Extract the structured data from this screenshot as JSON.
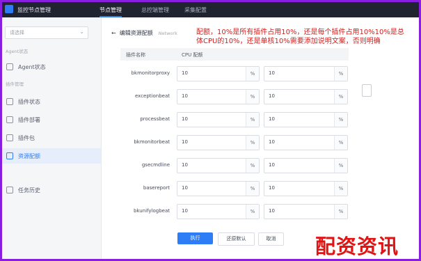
{
  "app": {
    "name": "监控节点管理"
  },
  "topnav": [
    {
      "label": "节点管理",
      "active": true
    },
    {
      "label": "总控端管理",
      "active": false
    },
    {
      "label": "采集配置",
      "active": false
    }
  ],
  "sidebar": {
    "select_placeholder": "请选择",
    "group1": "Agent状态",
    "group2": "插件管理",
    "items": [
      {
        "label": "Agent状态",
        "active": false
      },
      {
        "label": "插件状态",
        "active": false
      },
      {
        "label": "插件部署",
        "active": false
      },
      {
        "label": "插件包",
        "active": false
      },
      {
        "label": "资源配额",
        "active": true
      },
      {
        "label": "任务历史",
        "active": false
      }
    ]
  },
  "page": {
    "back_label": "编辑资源配额",
    "back_sub": "Network",
    "annotation": "配额，10%是所有插件占用10%，还是每个插件占用10%10%是总体CPU的10%，还是单核10%需要添加说明文案，否则明确"
  },
  "table": {
    "col_name": "插件名称",
    "col_cpu": "CPU 配额",
    "unit": "%",
    "rows": [
      {
        "name": "bkmonitorproxy",
        "cpu": "10",
        "mem": "10"
      },
      {
        "name": "exceptionbeat",
        "cpu": "10",
        "mem": "10"
      },
      {
        "name": "processbeat",
        "cpu": "10",
        "mem": "10"
      },
      {
        "name": "bkmonitorbeat",
        "cpu": "10",
        "mem": "10"
      },
      {
        "name": "gsecmdline",
        "cpu": "10",
        "mem": "10"
      },
      {
        "name": "basereport",
        "cpu": "10",
        "mem": "10"
      },
      {
        "name": "bkunifylogbeat",
        "cpu": "10",
        "mem": "10"
      }
    ]
  },
  "buttons": {
    "execute": "执行",
    "restore": "还原默认",
    "cancel": "取消"
  },
  "watermark": "配资资讯",
  "colors": {
    "accent": "#2f7df6",
    "annotation": "#d2211f",
    "frame": "#8a1ee0"
  }
}
